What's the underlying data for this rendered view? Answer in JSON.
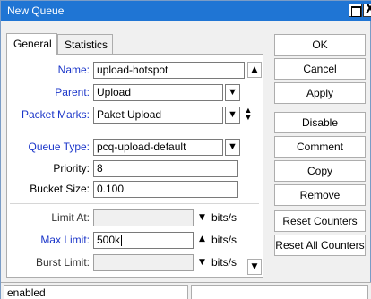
{
  "window": {
    "title": "New Queue",
    "maximize_label": "",
    "close_label": "X"
  },
  "tabs": [
    {
      "label": "General",
      "active": true
    },
    {
      "label": "Statistics",
      "active": false
    }
  ],
  "form": {
    "name": {
      "label": "Name:",
      "value": "upload-hotspot"
    },
    "parent": {
      "label": "Parent:",
      "value": "Upload"
    },
    "packet_marks": {
      "label": "Packet Marks:",
      "value": "Paket Upload"
    },
    "queue_type": {
      "label": "Queue Type:",
      "value": "pcq-upload-default"
    },
    "priority": {
      "label": "Priority:",
      "value": "8"
    },
    "bucket_size": {
      "label": "Bucket Size:",
      "value": "0.100"
    },
    "limit_at": {
      "label": "Limit At:",
      "value": "",
      "unit": "bits/s"
    },
    "max_limit": {
      "label": "Max Limit:",
      "value": "500k",
      "unit": "bits/s"
    },
    "burst_limit": {
      "label": "Burst Limit:",
      "value": "",
      "unit": "bits/s"
    }
  },
  "buttons": {
    "ok": "OK",
    "cancel": "Cancel",
    "apply": "Apply",
    "disable": "Disable",
    "comment": "Comment",
    "copy": "Copy",
    "remove": "Remove",
    "reset_counters": "Reset Counters",
    "reset_all_counters": "Reset All Counters"
  },
  "status": {
    "text": "enabled",
    "secondary": ""
  },
  "icons": {
    "scroll_up": "triangle-up-icon",
    "scroll_down": "triangle-down-icon",
    "dropdown": "dropdown-arrow-icon",
    "updown": "up-down-icon"
  },
  "colors": {
    "titlebar": "#1f75d4",
    "label_highlight": "#1a35c9"
  }
}
